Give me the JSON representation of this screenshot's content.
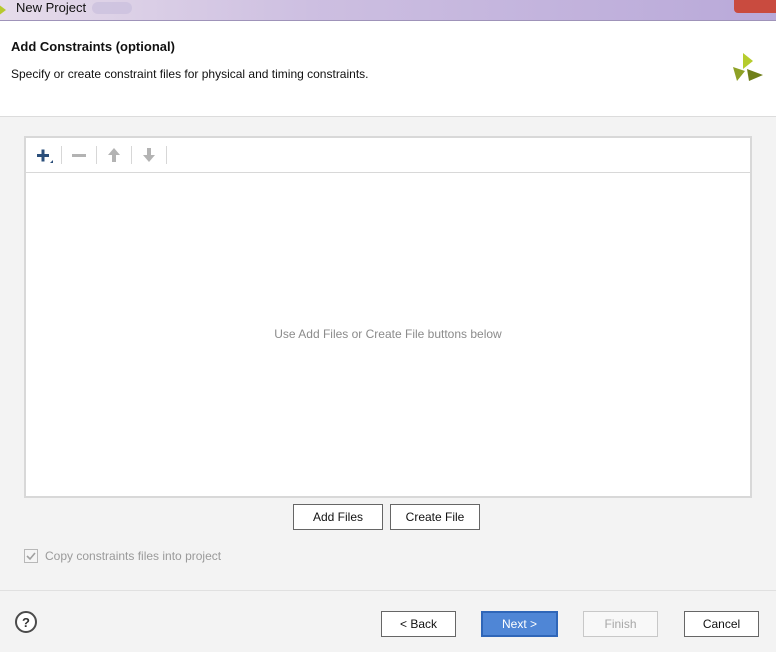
{
  "window": {
    "title": "New Project"
  },
  "header": {
    "title": "Add Constraints (optional)",
    "subtitle": "Specify or create constraint files for physical and timing constraints."
  },
  "toolbar": {
    "icons": [
      "add-icon",
      "remove-icon",
      "move-up-icon",
      "move-down-icon"
    ]
  },
  "file_list": {
    "empty_message": "Use Add Files or Create File buttons below"
  },
  "actions": {
    "add_files": "Add Files",
    "create_file": "Create File"
  },
  "option": {
    "copy_label": "Copy constraints files into project",
    "checked": true,
    "enabled": false
  },
  "footer": {
    "help": "?",
    "back": "< Back",
    "next": "Next >",
    "finish": "Finish",
    "cancel": "Cancel"
  },
  "colors": {
    "accent": "#4f86d6",
    "logo_light": "#c9df3a",
    "logo_dark": "#7c8c1f"
  }
}
